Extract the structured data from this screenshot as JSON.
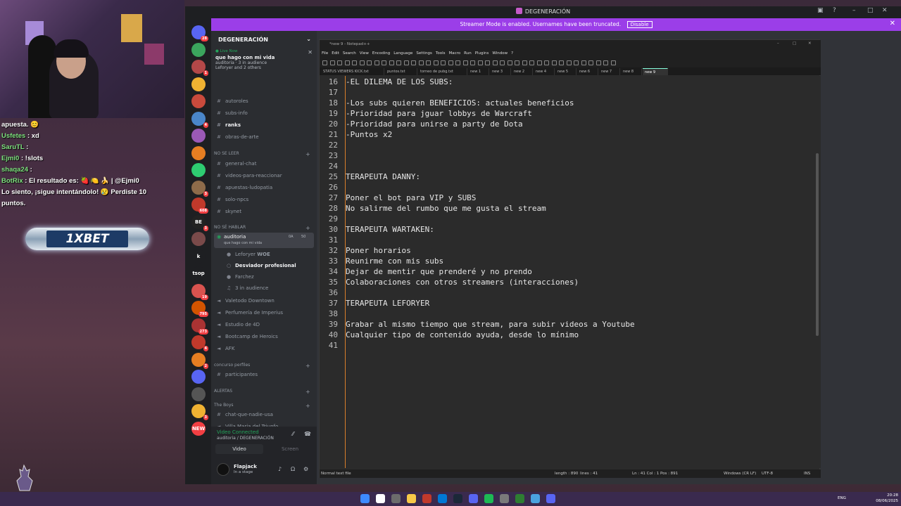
{
  "overlay_chat": [
    {
      "user": "",
      "text": "apuesta. 😊",
      "color": "#ffffff"
    },
    {
      "user": "Usfetes",
      "text": ": xd",
      "color": "#7ee27e"
    },
    {
      "user": "SaruTL",
      "text": ":",
      "color": "#7ee27e"
    },
    {
      "user": "Ejmi0",
      "text": ": !slots",
      "color": "#7ee27e"
    },
    {
      "user": "shaqa24",
      "text": ":",
      "color": "#7ee27e"
    },
    {
      "user": "BotRix",
      "text": ": El resultado es: 🍓 🍋 🍌 | @Ejmi0",
      "color": "#7ee27e"
    },
    {
      "user": "",
      "text": "Lo siento, ¡sigue intentándolo! 😢 Perdiste 10",
      "color": "#ffffff"
    },
    {
      "user": "",
      "text": "puntos.",
      "color": "#ffffff"
    }
  ],
  "banner": {
    "text": "1XBET"
  },
  "discord": {
    "window_title": "DEGENERACIÓN",
    "streamer_mode": {
      "text": "Streamer Mode is enabled. Usernames have been truncated.",
      "button": "Disable"
    },
    "server_name": "DEGENERACIÓN",
    "live": {
      "tag": "● Live Now",
      "title": "que hago con mi vida",
      "meta1": "auditoria · 3 in audience",
      "meta2": "Leforyer and 2 others"
    },
    "channels": [
      {
        "name": "autoroles",
        "type": "text"
      },
      {
        "name": "subs-info",
        "type": "text"
      },
      {
        "name": "ranks",
        "type": "text",
        "bold": true
      },
      {
        "name": "obras-de-arte",
        "type": "text"
      }
    ],
    "cat_no_se_leer": "NO SE LEER",
    "channels2": [
      {
        "name": "general-chat"
      },
      {
        "name": "videos-para-reaccionar"
      },
      {
        "name": "apuestas-ludopatia"
      },
      {
        "name": "solo-npcs"
      },
      {
        "name": "skynet"
      }
    ],
    "cat_no_se_hablar": "NO SÉ HABLAR",
    "voice_active": {
      "name": "auditoria",
      "sub": "que hago con mi vida",
      "count1": "0A",
      "count2": "50"
    },
    "voice_users": [
      {
        "name": "Leforyer",
        "tag": "WOE"
      },
      {
        "name": "Desviador profesional",
        "tag": ""
      },
      {
        "name": "Farchez",
        "tag": ""
      }
    ],
    "audience": "3 in audience",
    "voice_channels": [
      "Valetodo Downtown",
      "Perfumería de Imperius",
      "Estudio de 4D",
      "Bootcamp de Heroics",
      "AFK"
    ],
    "cat_concurso": "concurso perfiles",
    "participantes": "participantes",
    "cat_alertas": "ALERTAS",
    "cat_boys": "The Boys",
    "boys_channels": [
      "chat-que-nadie-usa",
      "Villa Maria del Triunfo"
    ],
    "voice_panel": {
      "connected": "Video Connected",
      "sub": "auditoria / DEGENERACIÓN",
      "video": "Video",
      "screen": "Screen"
    },
    "user": {
      "name": "Flapjack",
      "status": "In a stage"
    }
  },
  "notepad": {
    "title": "*new 9 - Notepad++",
    "menu": [
      "File",
      "Edit",
      "Search",
      "View",
      "Encoding",
      "Language",
      "Settings",
      "Tools",
      "Macro",
      "Run",
      "Plugins",
      "Window",
      "?"
    ],
    "tabs": [
      "STATUS VIEWERS KICK.txt",
      "puntos.txt",
      "torneo de pubg.txt",
      "new 1",
      "new 3",
      "new 2",
      "new 4",
      "new 5",
      "new 6",
      "new 7",
      "new 8",
      "new 9"
    ],
    "lines": [
      {
        "n": "16",
        "t": "-EL DILEMA DE LOS SUBS:"
      },
      {
        "n": "17",
        "t": ""
      },
      {
        "n": "18",
        "t": "-Los subs quieren BENEFICIOS: actuales beneficios"
      },
      {
        "n": "19",
        "t": "-Prioridad para jguar lobbys de Warcraft"
      },
      {
        "n": "20",
        "t": "-Prioridad para unirse a party de Dota"
      },
      {
        "n": "21",
        "t": "-Puntos x2"
      },
      {
        "n": "22",
        "t": ""
      },
      {
        "n": "23",
        "t": ""
      },
      {
        "n": "24",
        "t": ""
      },
      {
        "n": "25",
        "t": "TERAPEUTA DANNY:"
      },
      {
        "n": "26",
        "t": ""
      },
      {
        "n": "27",
        "t": "Poner el bot para VIP y SUBS"
      },
      {
        "n": "28",
        "t": "No salirme del rumbo que me gusta el stream"
      },
      {
        "n": "29",
        "t": ""
      },
      {
        "n": "30",
        "t": "TERAPEUTA WARTAKEN:"
      },
      {
        "n": "31",
        "t": ""
      },
      {
        "n": "32",
        "t": "Poner horarios"
      },
      {
        "n": "33",
        "t": "Reunirme con mis subs"
      },
      {
        "n": "34",
        "t": "Dejar de mentir que prenderé y no prendo"
      },
      {
        "n": "35",
        "t": "Colaboraciones con otros streamers (interacciones)"
      },
      {
        "n": "36",
        "t": ""
      },
      {
        "n": "37",
        "t": "TERAPEUTA LEFORYER"
      },
      {
        "n": "38",
        "t": ""
      },
      {
        "n": "39",
        "t": "Grabar al mismo tiempo que stream, para subir videos a Youtube"
      },
      {
        "n": "40",
        "t": "Cualquier tipo de contenido ayuda, desde lo mínimo"
      },
      {
        "n": "41",
        "t": ""
      }
    ],
    "status": {
      "type": "Normal text file",
      "length": "length : 890",
      "lines": "lines : 41",
      "pos": "Ln : 41   Col : 1   Pos : 891",
      "eol": "Windows (CR LF)",
      "enc": "UTF-8",
      "ins": "INS"
    }
  },
  "taskbar": {
    "lang": "ENG",
    "time": "20:28",
    "date": "08/06/2025"
  },
  "sidebar_servers": [
    {
      "label": "",
      "color": "#5865f2",
      "badge": "28"
    },
    {
      "label": "",
      "color": "#3ba55d",
      "badge": ""
    },
    {
      "label": "",
      "color": "#b34848",
      "badge": "1"
    },
    {
      "label": "",
      "color": "#f0b232",
      "badge": ""
    },
    {
      "label": "",
      "color": "#c94a3c",
      "badge": ""
    },
    {
      "label": "",
      "color": "#4a86c9",
      "badge": "4"
    },
    {
      "label": "",
      "color": "#9b59b6",
      "badge": ""
    },
    {
      "label": "",
      "color": "#e67e22",
      "badge": ""
    },
    {
      "label": "",
      "color": "#2ecc71",
      "badge": ""
    },
    {
      "label": "",
      "color": "#8e6b4a",
      "badge": "3"
    },
    {
      "label": "",
      "color": "#c0392b",
      "badge": "608"
    },
    {
      "label": "BE",
      "color": "#222222",
      "badge": "3"
    },
    {
      "label": "",
      "color": "#7a4a4a",
      "badge": ""
    },
    {
      "label": "k",
      "color": "#1e1f22",
      "badge": ""
    },
    {
      "label": "tsop",
      "color": "#1e1f22",
      "badge": ""
    },
    {
      "label": "",
      "color": "#d9534f",
      "badge": "19"
    },
    {
      "label": "",
      "color": "#d35400",
      "badge": "795"
    },
    {
      "label": "",
      "color": "#a33",
      "badge": "273"
    },
    {
      "label": "",
      "color": "#c0392b",
      "badge": "4"
    },
    {
      "label": "",
      "color": "#e67e22",
      "badge": "2"
    },
    {
      "label": "",
      "color": "#5865f2",
      "badge": ""
    },
    {
      "label": "",
      "color": "#555",
      "badge": ""
    },
    {
      "label": "",
      "color": "#f0b232",
      "badge": "3"
    },
    {
      "label": "NEW",
      "color": "#f23f43",
      "badge": ""
    }
  ]
}
